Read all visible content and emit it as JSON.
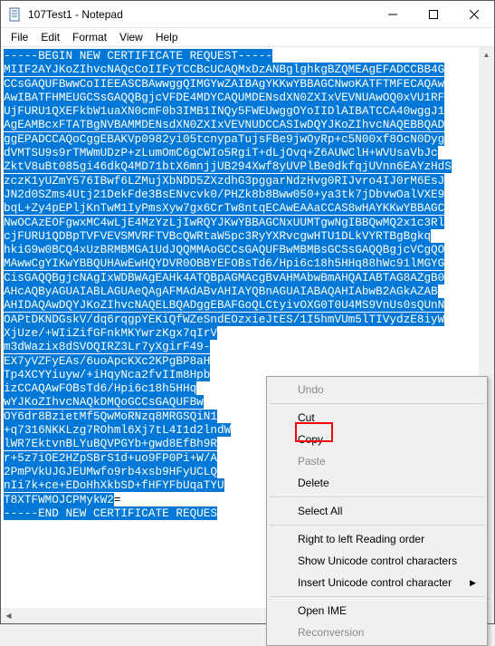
{
  "window": {
    "title": "107Test1 - Notepad"
  },
  "menubar": {
    "file": "File",
    "edit": "Edit",
    "format": "Format",
    "view": "View",
    "help": "Help"
  },
  "editor": {
    "lines": [
      "-----BEGIN NEW CERTIFICATE REQUEST-----",
      "MIIF2AYJKoZIhvcNAQcCoIIFyTCCBcUCAQMxDzANBglghkgBZQMEAgEFADCCBB4G",
      "CCsGAQUFBwwCoIIEEASCBAwwggQIMGYwZAIBAgYKKwYBBAGCNwoKATFTMFECAQAw",
      "AwIBATFHMEUGCSsGAQQBgjcVFDE4MDYCAQUMDENsdXN0ZXIxVEVNUAwOQ0xVU1RF",
      "UjFURU1QXEFkbW1uaXN0cmF0b3IMB1INQy5FWEUwggOYoIIDlAIBATCCA40wggJ1",
      "AgEAMBcxFTATBgNVBAMMDENsdXN0ZXIxVEVNUDCCASIwDQYJKoZIhvcNAQEBBQAD",
      "ggEPADCCAQoCggEBAKVp0982yi05tcnypaTujsFBe9jwOyRp+c5N00xf8OcN0Dyg",
      "dVMTSU9s9rTMWmUDzP+zLumOmC6gCWIo5RgiT+dLjOvq+Z6AUWClH+WVUsaVbJc",
      "ZktV8uBt085gi46dkQ4MD71btX6mnjjUB294Xwf8yUVPlBe0dkfqjUVnn6EAYzHdS",
      "zczK1yUZmY576IBwf6LZMujXbNDD5ZXzdhG3pggarNdzHvg0RIJvro4IJ0rM6EsJ",
      "JN2d0SZms4Utj21DekFde3BsENvcvk0/PHZk8b8Bww050+ya3tk7jDbvwOalVXE9",
      "bqL+Zy4pEPljKnTwM1IyPmsXyw7gx6CrTw8ntqECAwEAAaCCAS8wHAYKKwYBBAGC",
      "NwOCAzEOFgwxMC4wLjE4MzYzLjIwRQYJKwYBBAGCNxUUMTgwNgIBBQwMQ2x1c3Rl",
      "cjFURU1QDBpTVFVEVSMVRFTVBcQWRtaW5pc3RyYXRvcgwHTU1DLkVYRTBgBgkq",
      "hkiG9w0BCQ4xUzBRMBMGA1UdJQQMMAoGCCsGAQUFBwMBMBsGCSsGAQQBgjcVCgQO",
      "MAwwCgYIKwYBBQUHAwEwHQYDVR0OBBYEFOBsTd6/Hpi6c18h5HHq88hWc91lMGYG",
      "CisGAQQBgjcNAgIxWDBWAgEAHk4ATQBpAGMAcgBvAHMAbwBmAHQAIABTAG8AZgB0",
      "AHcAQByAGUAIABLAGUAeQAgAFMAdABvAHIAYQBnAGUAIABAQAHIAbwB2AGkAZAB",
      "AHIDAQAwDQYJKoZIhvcNAQELBQADggEBAFGoQLCtyivOXG0T0U4MS9VnUs0sQUnN",
      "OAPtDKNDGskV/dq6rqgpYEKiQfWZeSndEOzxieJtES/1I5hmVUm5lTIVydzE8iyW",
      "XjUze/+WIiZifGFnkMKYwrzKgx7qIrV",
      "m3dWazix8dSVOQIRZ3Lr7yXgirF49-",
      "EX7yVZFyEAs/6uoApcKXc2KPgBP8aH",
      "Tp4XCYYiuyw/+iHqyNca2fvIIm8Hpb",
      "izCCAQAwFOBsTd6/Hpi6c18h5HHq",
      "wYJKoZIhvcNAQkDMQoGCCsGAQUFBw",
      "OY6dr8BzietMf5QwMoRNzq8MRGSQiN1",
      "+q7316NKKLzg7ROhml6Xj7tL4I1d2lndW",
      "lWR7EktvnBLYuBQVPGYb+gwd8EfBh9R",
      "r+5z7iOE2HZpSBrS1d+uo9FP0Pi+W/A",
      "2PmPVkUJGJEUMwfo9rb4xsb9HFyUCLQ",
      "nIi7k+ce+EDoHhXkbSD+fHFYFbUqaTYU",
      "T8XTFWMOJCPMykW2"
    ],
    "unselected_tail": "=",
    "end_line": "-----END NEW CERTIFICATE REQUES"
  },
  "context_menu": {
    "undo": "Undo",
    "cut": "Cut",
    "copy": "Copy",
    "paste": "Paste",
    "delete": "Delete",
    "select_all": "Select All",
    "rtl": "Right to left Reading order",
    "show_unicode": "Show Unicode control characters",
    "insert_unicode": "Insert Unicode control character",
    "open_ime": "Open IME",
    "reconversion": "Reconversion"
  }
}
